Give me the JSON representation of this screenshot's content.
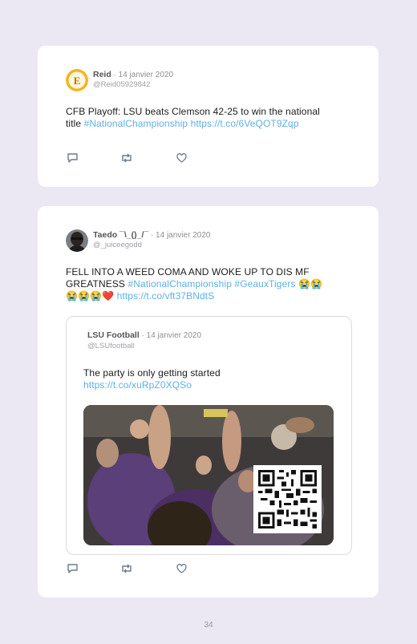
{
  "tweet1": {
    "name": "Reid",
    "date": "· 14 janvier 2020",
    "handle": "@Reid05929842",
    "text_line1": "CFB Playoff: LSU beats Clemson 42-25 to win the national",
    "text_line2_plain": "title ",
    "hashtag": "#NationalChampionship",
    "link": "https://t.co/6VeQOT9Zqp"
  },
  "tweet2": {
    "name": "Taedo ¯\\_()_/¯",
    "date": "· 14 janvier 2020",
    "handle": "@_juiceegodd",
    "line1": "FELL INTO A WEED COMA AND WOKE UP TO DIS MF",
    "line2_plain": "GREATNESS ",
    "hashtag1": "#NationalChampionship",
    "hashtag2": "#GeauxTigers",
    "emoji_line2": " 😭😭",
    "emoji_line3": "😭😭😭❤️",
    "link": "https://t.co/vft37BNdtS",
    "quote": {
      "name": "LSU Football",
      "date": "· 14 janvier 2020",
      "handle": "@LSUfootball",
      "text": "The party is only getting started",
      "link": "https://t.co/xuRpZ0XQSo"
    }
  },
  "icons": {
    "reply": "reply-icon",
    "retweet": "retweet-icon",
    "like": "heart-icon"
  },
  "page_number": "34"
}
